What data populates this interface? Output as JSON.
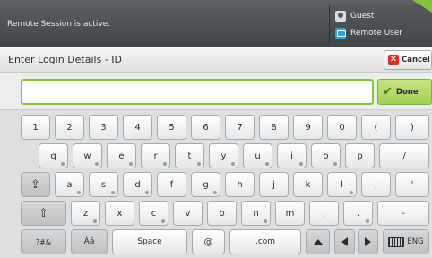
{
  "status_bar": {
    "message": "Remote Session is active.",
    "user_panel": {
      "guest_label": "Guest",
      "remote_label": "Remote User",
      "guest_icon": "guest-user-icon",
      "remote_icon": "remote-user-icon"
    },
    "accent_color": "#86c23b"
  },
  "title_bar": {
    "title": "Enter Login Details - ID",
    "cancel_label": "Cancel",
    "cancel_icon": "close-icon"
  },
  "input": {
    "value": "",
    "done_label": "Done",
    "done_icon": "checkmark-icon"
  },
  "keyboard": {
    "row1": [
      "1",
      "2",
      "3",
      "4",
      "5",
      "6",
      "7",
      "8",
      "9",
      "0",
      "(",
      ")"
    ],
    "row2": [
      "q",
      "w",
      "e",
      "r",
      "t",
      "y",
      "u",
      "i",
      "o",
      "p",
      "/"
    ],
    "row3": [
      "a",
      "s",
      "d",
      "f",
      "g",
      "h",
      "j",
      "k",
      "l",
      ";",
      "'"
    ],
    "row4": [
      "z",
      "x",
      "c",
      "v",
      "b",
      "n",
      "m",
      ",",
      ".",
      "-"
    ],
    "bottom": {
      "symbols_label": "?#&",
      "accents_label": "Àá",
      "space_label": "Space",
      "at_label": "@",
      "dotcom_label": ".com",
      "language_label": "ENG"
    }
  }
}
